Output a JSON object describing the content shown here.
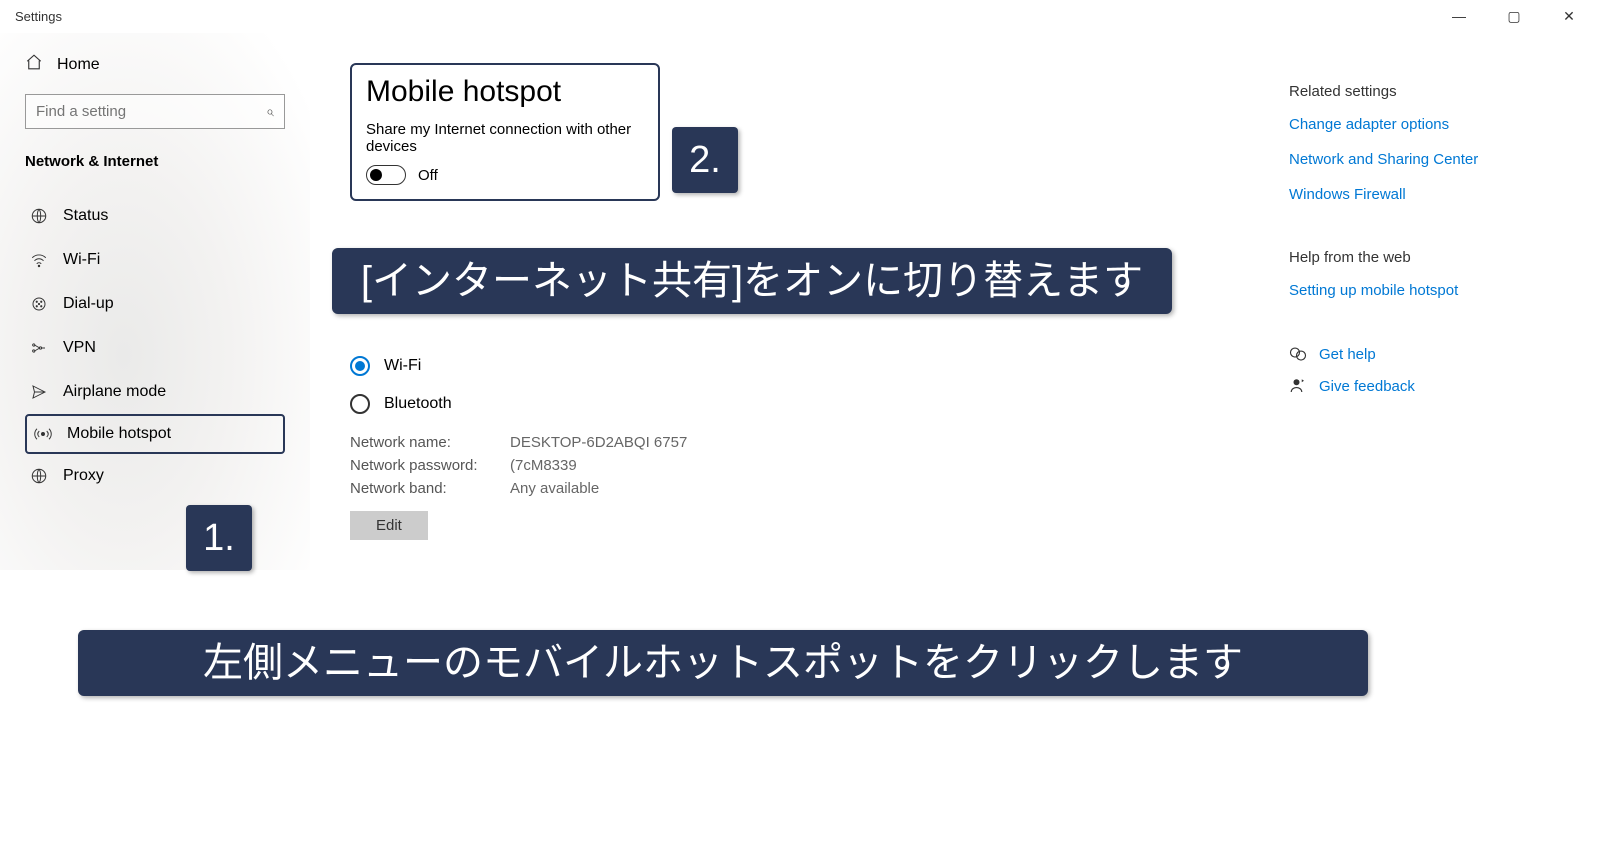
{
  "window": {
    "title": "Settings"
  },
  "sidebar": {
    "home": "Home",
    "search_placeholder": "Find a setting",
    "section": "Network & Internet",
    "items": [
      {
        "label": "Status"
      },
      {
        "label": "Wi-Fi"
      },
      {
        "label": "Dial-up"
      },
      {
        "label": "VPN"
      },
      {
        "label": "Airplane mode"
      },
      {
        "label": "Mobile hotspot"
      },
      {
        "label": "Proxy"
      }
    ]
  },
  "main": {
    "title": "Mobile hotspot",
    "subtitle": "Share my Internet connection with other devices",
    "toggle_state": "Off",
    "radios": {
      "wifi": "Wi-Fi",
      "bluetooth": "Bluetooth"
    },
    "details": {
      "name_lbl": "Network name:",
      "name_val": "DESKTOP-6D2ABQI 6757",
      "pass_lbl": "Network password:",
      "pass_val": "(7cM8339",
      "band_lbl": "Network band:",
      "band_val": "Any available",
      "edit": "Edit"
    }
  },
  "rightpane": {
    "related_heading": "Related settings",
    "adapter": "Change adapter options",
    "sharing": "Network and Sharing Center",
    "firewall": "Windows Firewall",
    "help_heading": "Help from the web",
    "setting_up": "Setting up mobile hotspot",
    "get_help": "Get help",
    "feedback": "Give feedback"
  },
  "callouts": {
    "num1": "1.",
    "num2": "2.",
    "text1": "左側メニューのモバイルホットスポットをクリックします",
    "text2": "[インターネット共有]をオンに切り替えます"
  }
}
